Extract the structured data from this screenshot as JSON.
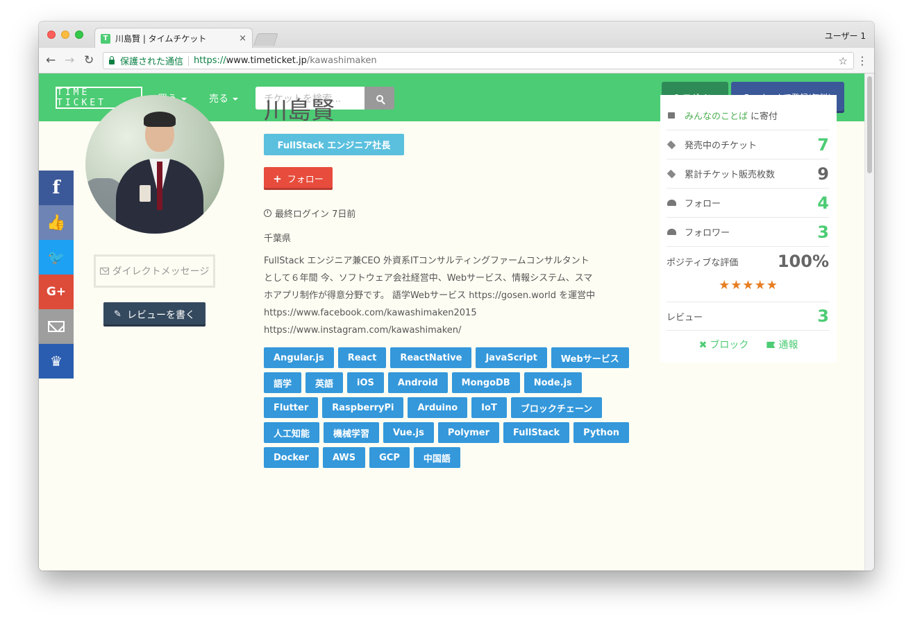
{
  "browser": {
    "tab_title": "川島賢 | タイムチケット",
    "tab_favicon": "T",
    "tab_close": "×",
    "profile": "ユーザー 1",
    "secure_label": "保護された通信",
    "url_scheme": "https://",
    "url_host": "www.timeticket.jp",
    "url_path": "/kawashimaken",
    "icons": {
      "back": "back-arrow-icon",
      "forward": "forward-arrow-icon",
      "reload": "reload-icon",
      "star": "bookmark-star-icon",
      "menu": "more-vert-icon"
    }
  },
  "header": {
    "logo": "TIME TICKET",
    "menu_buy": "買う",
    "menu_sell": "売る",
    "search_placeholder": "チケットを検索...",
    "login": "ログイン",
    "facebook_signup": "Facebookで登録(無料)",
    "brand_color": "#4ccc74"
  },
  "social": {
    "facebook": "f",
    "like": "👍",
    "twitter": "🐦",
    "googleplus": "G+",
    "crown": "♛"
  },
  "profile": {
    "name": "川島賢",
    "role": "FullStack エンジニア社長",
    "follow": "フォロー",
    "last_login": "最終ログイン 7日前",
    "location": "千葉県",
    "bio_lines": [
      "FullStack エンジニア兼CEO 外資系ITコンサルティングファームコンサルタント",
      "として６年間 今、ソフトウェア会社経営中、Webサービス、情報システム、スマ",
      "ホアプリ制作が得意分野です。 語学Webサービス https://gosen.world を運営中",
      "https://www.facebook.com/kawashimaken2015",
      "https://www.instagram.com/kawashimaken/"
    ],
    "direct_message": "ダイレクトメッセージ",
    "write_review": "レビューを書く",
    "tags": [
      "Angular.js",
      "React",
      "ReactNative",
      "JavaScript",
      "Webサービス",
      "語学",
      "英語",
      "iOS",
      "Android",
      "MongoDB",
      "Node.js",
      "Flutter",
      "RaspberryPi",
      "Arduino",
      "IoT",
      "ブロックチェーン",
      "人工知能",
      "機械学習",
      "Vue.js",
      "Polymer",
      "FullStack",
      "Python",
      "Docker",
      "AWS",
      "GCP",
      "中国語"
    ]
  },
  "stats": {
    "donate_link": "みんなのことば",
    "donate_suffix": "に寄付",
    "tickets_on_sale_label": "発売中のチケット",
    "tickets_on_sale": "7",
    "total_sold_label": "累計チケット販売枚数",
    "total_sold": "9",
    "following_label": "フォロー",
    "following": "4",
    "followers_label": "フォロワー",
    "followers": "3",
    "positive_label": "ポジティブな評価",
    "positive": "100%",
    "stars": "★★★★★",
    "star_rating": 5,
    "reviews_label": "レビュー",
    "reviews": "3",
    "block": "ブロック",
    "report": "通報"
  }
}
